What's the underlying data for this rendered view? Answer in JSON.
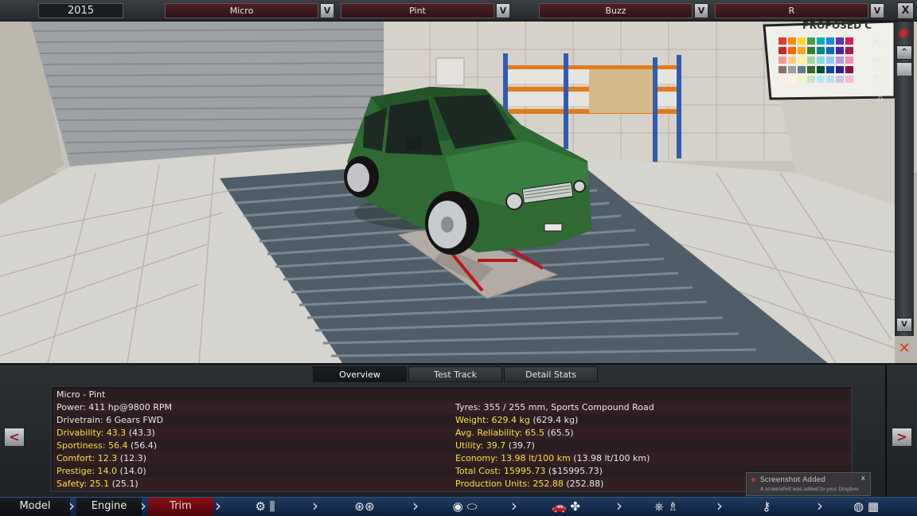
{
  "top_bar": {
    "year": "2015",
    "selectors": [
      {
        "value": "Micro",
        "button": "V"
      },
      {
        "value": "Pint",
        "button": "V"
      },
      {
        "value": "Buzz",
        "button": "V"
      },
      {
        "value": "R",
        "button": "V"
      }
    ],
    "close_label": "X"
  },
  "viewport": {
    "poster_text": "PROPOSED C",
    "scroll_up": "^",
    "scroll_down": "V"
  },
  "tabs": [
    "Overview",
    "Test Track",
    "Detail Stats"
  ],
  "stats": {
    "title": "Micro - Pint",
    "left": [
      {
        "label": "Power:",
        "value": "411 hp@9800 RPM",
        "ref": "",
        "highlight": false
      },
      {
        "label": "Drivetrain:",
        "value": "6 Gears FWD",
        "ref": "",
        "highlight": false
      },
      {
        "label": "Drivability:",
        "value": "43.3",
        "ref": "(43.3)",
        "highlight": true
      },
      {
        "label": "Sportiness:",
        "value": "56.4",
        "ref": "(56.4)",
        "highlight": true
      },
      {
        "label": "Comfort:",
        "value": "12.3",
        "ref": "(12.3)",
        "highlight": true
      },
      {
        "label": "Prestige:",
        "value": "14.0",
        "ref": "(14.0)",
        "highlight": true
      },
      {
        "label": "Safety:",
        "value": "25.1",
        "ref": "(25.1)",
        "highlight": true
      }
    ],
    "right": [
      {
        "label": "Tyres:",
        "value": "355 / 255 mm, Sports Compound Road",
        "ref": "",
        "highlight": false
      },
      {
        "label": "Weight:",
        "value": "629.4 kg",
        "ref": "(629.4 kg)",
        "highlight": true
      },
      {
        "label": "Avg. Reliability:",
        "value": "65.5",
        "ref": "(65.5)",
        "highlight": true
      },
      {
        "label": "Utility:",
        "value": "39.7",
        "ref": "(39.7)",
        "highlight": true
      },
      {
        "label": "Economy:",
        "value": "13.98 lt/100 km",
        "ref": "(13.98 lt/100 km)",
        "highlight": true
      },
      {
        "label": "Total Cost:",
        "value": "15995.73",
        "ref": "($15995.73)",
        "highlight": true
      },
      {
        "label": "Production Units:",
        "value": "252.88",
        "ref": "(252.88)",
        "highlight": true
      }
    ]
  },
  "side_arrows": {
    "prev": "<",
    "next": ">"
  },
  "toast": {
    "title": "Screenshot Added",
    "body": "A screenshot was added to your Dropbox.",
    "close": "x"
  },
  "nav": {
    "model": "Model",
    "engine": "Engine",
    "trim": "Trim"
  },
  "colors": {
    "highlight_text": "#f3e33a",
    "trim_active": "#8a0e16",
    "nav_blue": "#1e3a63",
    "car_green": "#2f6a34"
  }
}
